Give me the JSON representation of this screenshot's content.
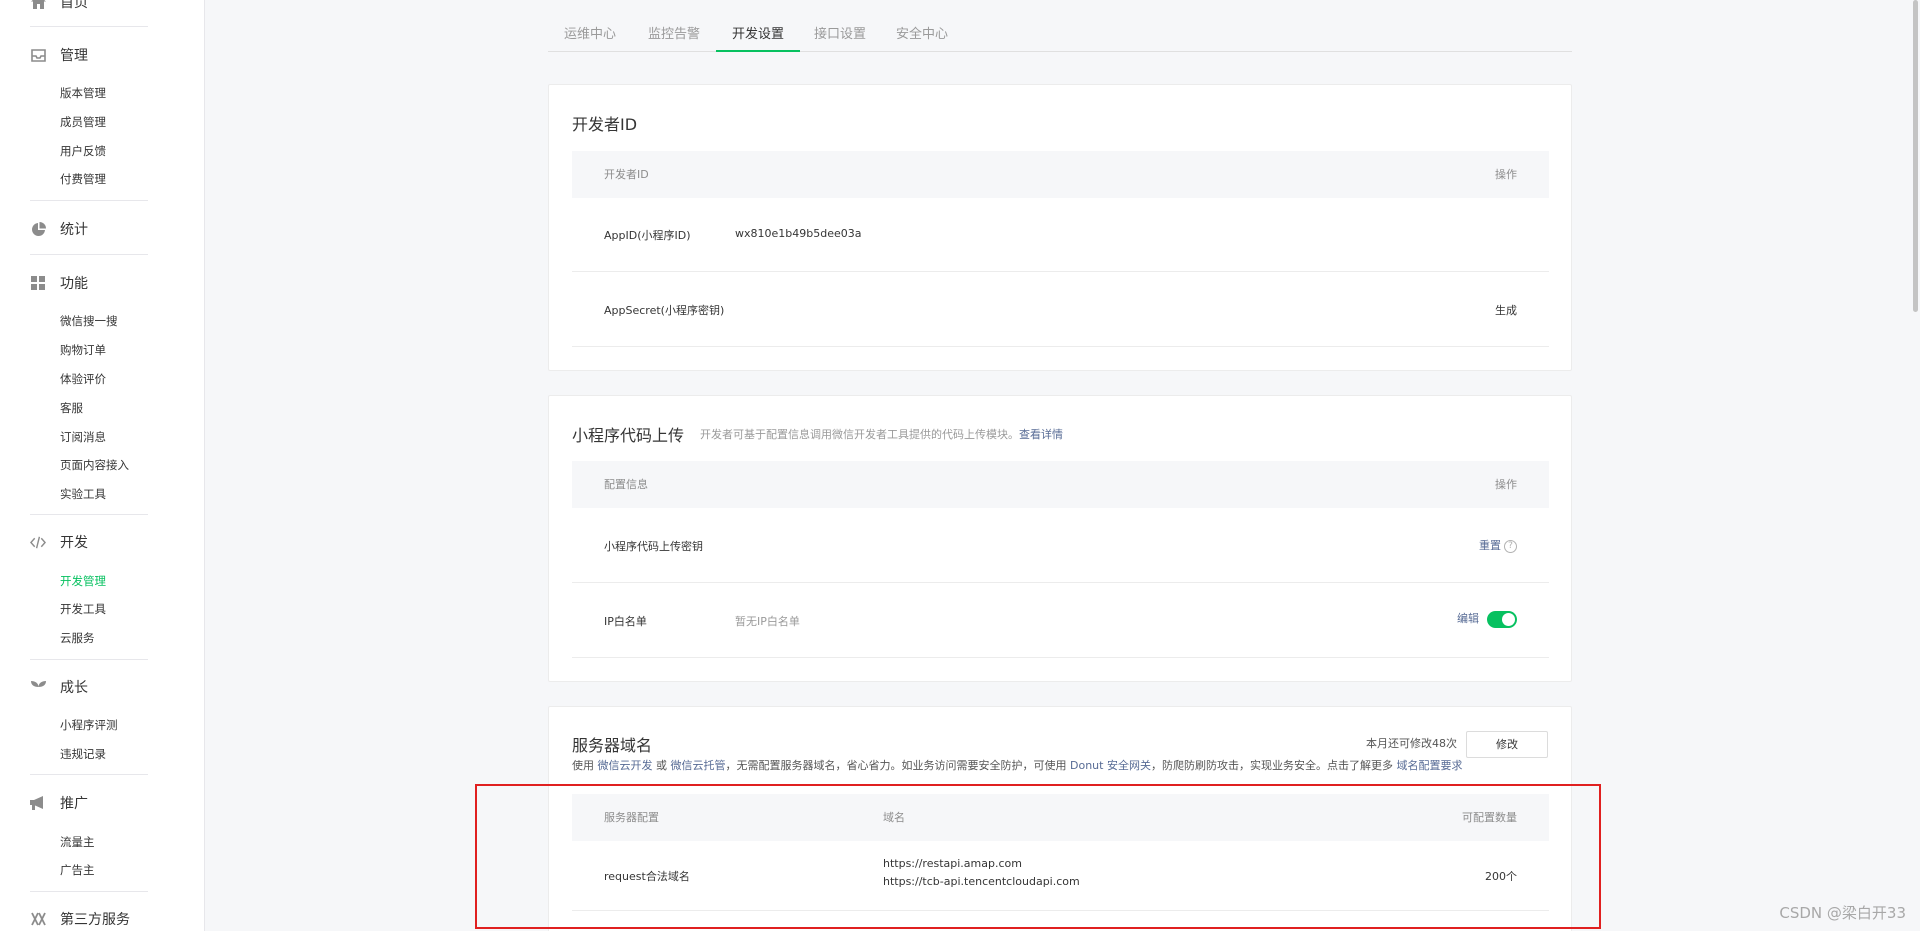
{
  "sidebar": {
    "home_label": "首页",
    "manage": {
      "label": "管理",
      "items": [
        "版本管理",
        "成员管理",
        "用户反馈",
        "付费管理"
      ]
    },
    "stats": {
      "label": "统计"
    },
    "features": {
      "label": "功能",
      "items": [
        "微信搜一搜",
        "购物订单",
        "体验评价",
        "客服",
        "订阅消息",
        "页面内容接入",
        "实验工具"
      ]
    },
    "dev": {
      "label": "开发",
      "items": [
        "开发管理",
        "开发工具",
        "云服务"
      ]
    },
    "growth": {
      "label": "成长",
      "items": [
        "小程序评测",
        "违规记录"
      ]
    },
    "promo": {
      "label": "推广",
      "items": [
        "流量主",
        "广告主"
      ]
    },
    "third": {
      "label": "第三方服务"
    }
  },
  "tabs": [
    "运维中心",
    "监控告警",
    "开发设置",
    "接口设置",
    "安全中心"
  ],
  "developer_id": {
    "title": "开发者ID",
    "header": {
      "col1": "开发者ID",
      "col2": "操作"
    },
    "appid": {
      "label": "AppID(小程序ID)",
      "value": "wx810e1b49b5dee03a"
    },
    "secret": {
      "label": "AppSecret(小程序密钥)",
      "action": "生成"
    }
  },
  "upload": {
    "title": "小程序代码上传",
    "desc": "开发者可基于配置信息调用微信开发者工具提供的代码上传模块。",
    "desc_link": "查看详情",
    "header": {
      "col1": "配置信息",
      "col2": "操作"
    },
    "key_row": {
      "label": "小程序代码上传密钥",
      "action": "重置",
      "help": "?"
    },
    "ip_row": {
      "label": "IP白名单",
      "value": "暂无IP白名单",
      "action": "编辑"
    }
  },
  "server": {
    "title": "服务器域名",
    "quota_text": "本月还可修改48次",
    "modify_label": "修改",
    "desc_parts": [
      "使用 ",
      "微信云开发",
      " 或 ",
      "微信云托管",
      "，无需配置服务器域名，省心省力。如业务访问需要安全防护，可使用 ",
      "Donut 安全网关",
      "，防爬防刷防攻击，实现业务安全。点击了解更多 ",
      "域名配置要求"
    ],
    "header": {
      "col1": "服务器配置",
      "col2": "域名",
      "col3": "可配置数量"
    },
    "row": {
      "label": "request合法域名",
      "domains": [
        "https://restapi.amap.com",
        "https://tcb-api.tencentcloudapi.com"
      ],
      "count": "200个"
    }
  },
  "watermark": "CSDN @梁白开33",
  "colors": {
    "accent": "#07c160",
    "link": "#576b95",
    "highlight_box": "#e02020"
  }
}
